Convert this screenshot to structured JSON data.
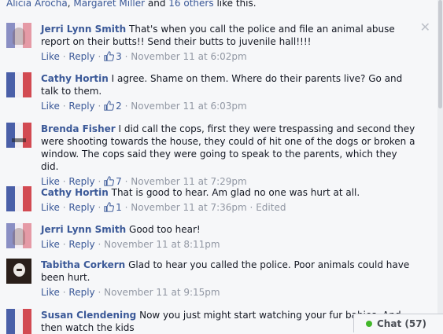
{
  "likes_line": {
    "names": [
      "Alicia Arocha",
      "Margaret Miller"
    ],
    "and_word": "and",
    "others": "16 others",
    "suffix": "like this."
  },
  "action_labels": {
    "like": "Like",
    "reply": "Reply",
    "dot": "·",
    "close": "✕"
  },
  "comments": [
    {
      "author": "Jerri Lynn Smith",
      "text": "That's when you call the police and file an animal abuse report on their butts!! Send their butts to juvenile hall!!!!",
      "likes": "3",
      "time": "November 11 at 6:02pm"
    },
    {
      "author": "Cathy Hortin",
      "text": "I agree. Shame on them. Where do their parents live? Go and talk to them.",
      "likes": "2",
      "time": "November 11 at 6:03pm"
    },
    {
      "author": "Brenda Fisher",
      "text": "I did call the cops, first they were trespassing and second they were shooting towards the house, they could of hit one of the dogs or broken a window. The cops said they were going to speak to the parents, which they did.",
      "likes": "7",
      "time": "November 11 at 7:29pm"
    },
    {
      "author": "Cathy Hortin",
      "text": "That is good to hear. Am glad no one was hurt at all.",
      "likes": "1",
      "time": "November 11 at 7:36pm",
      "edited": "Edited"
    },
    {
      "author": "Jerri Lynn Smith",
      "text": "Good too hear!",
      "time": "November 11 at 8:11pm"
    },
    {
      "author": "Tabitha Corkern",
      "text": "Glad to hear you called the police. Poor animals could have been hurt.",
      "time": "November 11 at 9:15pm"
    },
    {
      "author": "Susan Clendening",
      "text": "Now you just might start watching your fur babies. And then watch the kids"
    }
  ],
  "chat": {
    "label": "Chat (57)"
  },
  "colors": {
    "link": "#3b5998",
    "meta": "#9197a3",
    "online": "#42b72a",
    "background": "#f6f7f9"
  },
  "icons": [
    "close-icon",
    "thumbs-up-icon",
    "online-dot-icon"
  ]
}
